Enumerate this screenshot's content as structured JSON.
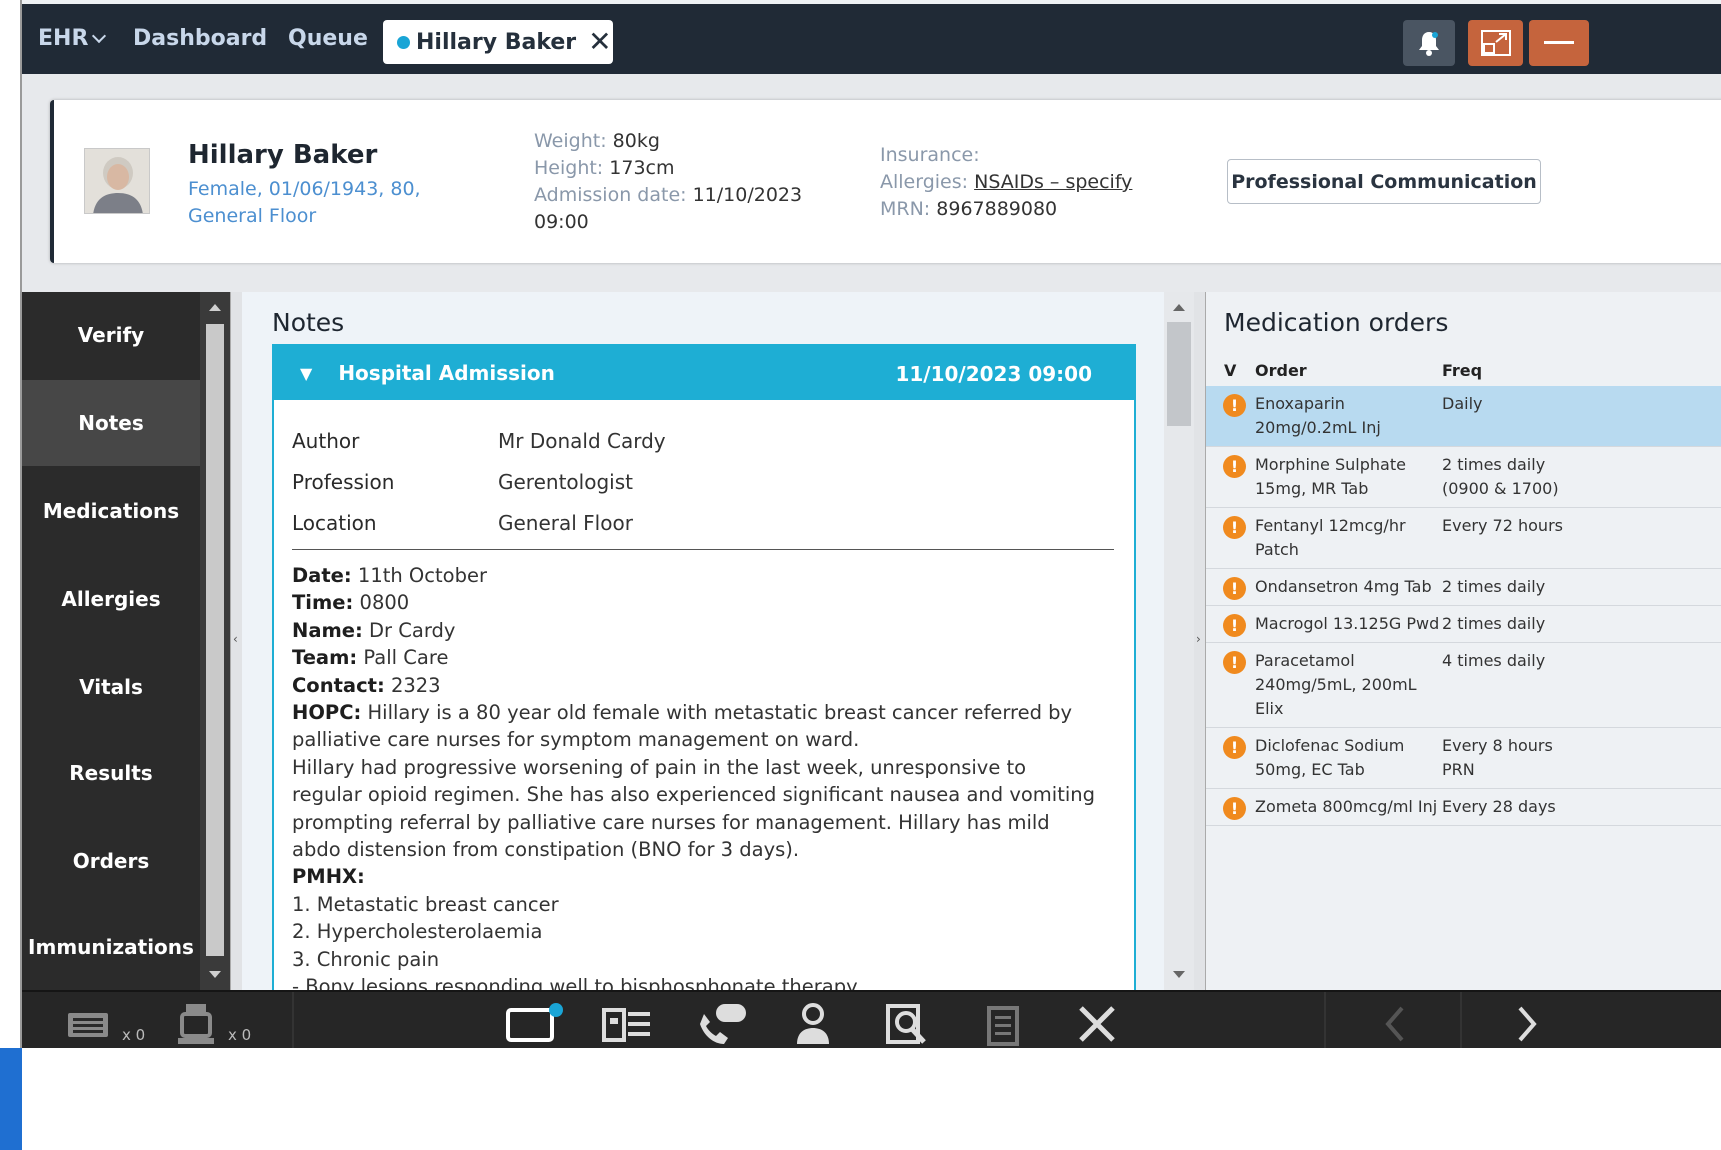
{
  "topbar": {
    "ehr_label": "EHR",
    "dashboard_label": "Dashboard",
    "queue_label": "Queue",
    "patient_tab": "Hillary Baker"
  },
  "patient": {
    "name": "Hillary Baker",
    "demographics": "Female, 01/06/1943, 80, General Floor",
    "weight_label": "Weight:",
    "weight": "80kg",
    "height_label": "Height:",
    "height": "173cm",
    "admission_label": "Admission date:",
    "admission": "11/10/2023 09:00",
    "insurance_label": "Insurance:",
    "insurance": "",
    "allergies_label": "Allergies:",
    "allergies": "NSAIDs – specify",
    "mrn_label": "MRN:",
    "mrn": "8967889080",
    "prof_comm_button": "Professional Communication"
  },
  "sidebar": {
    "items": [
      {
        "label": "Verify"
      },
      {
        "label": "Notes"
      },
      {
        "label": "Medications"
      },
      {
        "label": "Allergies"
      },
      {
        "label": "Vitals"
      },
      {
        "label": "Results"
      },
      {
        "label": "Orders"
      },
      {
        "label": "Immunizations"
      }
    ]
  },
  "notes": {
    "title": "Notes",
    "card": {
      "header_title": "Hospital Admission",
      "header_datetime": "11/10/2023 09:00",
      "meta": [
        {
          "key": "Author",
          "value": "Mr Donald Cardy"
        },
        {
          "key": "Profession",
          "value": "Gerentologist"
        },
        {
          "key": "Location",
          "value": "General Floor"
        }
      ],
      "body": {
        "date_label": "Date:",
        "date": "11th October",
        "time_label": "Time:",
        "time": "0800",
        "name_label": "Name:",
        "name": "Dr Cardy",
        "team_label": "Team:",
        "team": "Pall Care",
        "contact_label": "Contact:",
        "contact": "2323",
        "hopc_label": "HOPC:",
        "hopc": "Hillary is a 80 year old female with metastatic breast cancer referred by palliative care nurses for symptom management on ward.",
        "hopc2": "Hillary had progressive worsening of pain in the last week, unresponsive to regular opioid regimen. She has also experienced significant nausea and vomiting prompting referral by palliative care nurses for management. Hillary has mild abdo distension from constipation (BNO for 3 days).",
        "pmhx_label": "PMHX:",
        "pmhx": [
          "1. Metastatic breast cancer",
          "2. Hypercholesterolaemia",
          "3. Chronic pain",
          "- Bony lesions responding well to bisphosphonate therapy"
        ]
      }
    }
  },
  "medications": {
    "title": "Medication orders",
    "col_v": "V",
    "col_order": "Order",
    "col_freq": "Freq",
    "rows": [
      {
        "order": "Enoxaparin 20mg/0.2mL Inj",
        "freq": "Daily"
      },
      {
        "order": "Morphine Sulphate 15mg, MR Tab",
        "freq": "2 times daily (0900 & 1700)"
      },
      {
        "order": "Fentanyl 12mcg/hr Patch",
        "freq": "Every 72 hours"
      },
      {
        "order": "Ondansetron 4mg Tab",
        "freq": "2 times daily"
      },
      {
        "order": "Macrogol 13.125G Pwd",
        "freq": "2 times daily"
      },
      {
        "order": "Paracetamol 240mg/5mL, 200mL Elix",
        "freq": "4 times daily"
      },
      {
        "order": "Diclofenac Sodium 50mg, EC Tab",
        "freq": "Every 8 hours PRN"
      },
      {
        "order": "Zometa 800mcg/ml Inj",
        "freq": "Every 28 days"
      }
    ]
  },
  "bottombar": {
    "count1": "x 0",
    "count2": "x 0"
  },
  "colors": {
    "topbar": "#202a36",
    "accent": "#1eaed4",
    "warning": "#f08a1e",
    "selected_row": "#b8daf0",
    "action_orange": "#c5643d"
  }
}
